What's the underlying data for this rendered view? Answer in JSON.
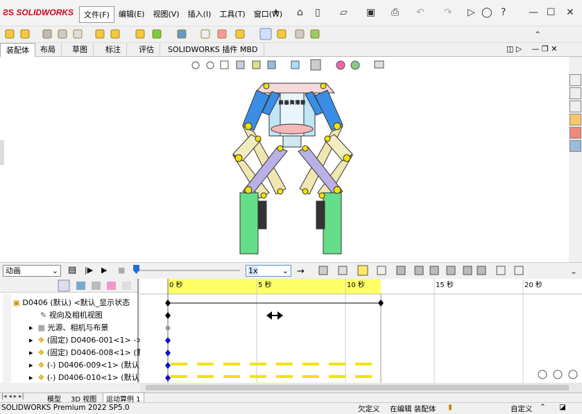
{
  "app": {
    "brand": "SOLIDWORKS"
  },
  "menu": [
    "文件(F)",
    "编辑(E)",
    "视图(V)",
    "插入(I)",
    "工具(T)",
    "窗口(W)"
  ],
  "tabs": [
    "装配体",
    "布局",
    "草图",
    "标注",
    "评估",
    "SOLIDWORKS 插件",
    "MBD"
  ],
  "motion": {
    "study_type": "动画",
    "speed": "1x"
  },
  "timeline": {
    "ticks": [
      "0 秒",
      "5 秒",
      "10 秒",
      "15 秒",
      "20 秒"
    ]
  },
  "tree": {
    "items": [
      {
        "label": "D0406 (默认) <默认_显示状态"
      },
      {
        "label": "视向及相机视图"
      },
      {
        "label": "光源、相机与布景"
      },
      {
        "label": "(固定) D0406-001<1> ->"
      },
      {
        "label": "(固定) D0406-008<1> (默"
      },
      {
        "label": "(-) D0406-009<1> (默认)"
      },
      {
        "label": "(-) D0406-010<1> (默认)"
      }
    ]
  },
  "bottom_tabs": [
    "模型",
    "3D 视图",
    "运动算例 1"
  ],
  "status": {
    "product": "SOLIDWORKS Premium 2022 SP5.0",
    "defined": "欠定义",
    "editing": "在编辑 装配体",
    "custom": "自定义"
  },
  "colors": {
    "timeline_yellow": "#ffff66",
    "key_blue": "#1010c0",
    "arm_blue": "#3a8ee6",
    "arm_cream": "#f0e6b0",
    "gripper_green": "#66dd88",
    "pin_yellow": "#f2e200"
  }
}
